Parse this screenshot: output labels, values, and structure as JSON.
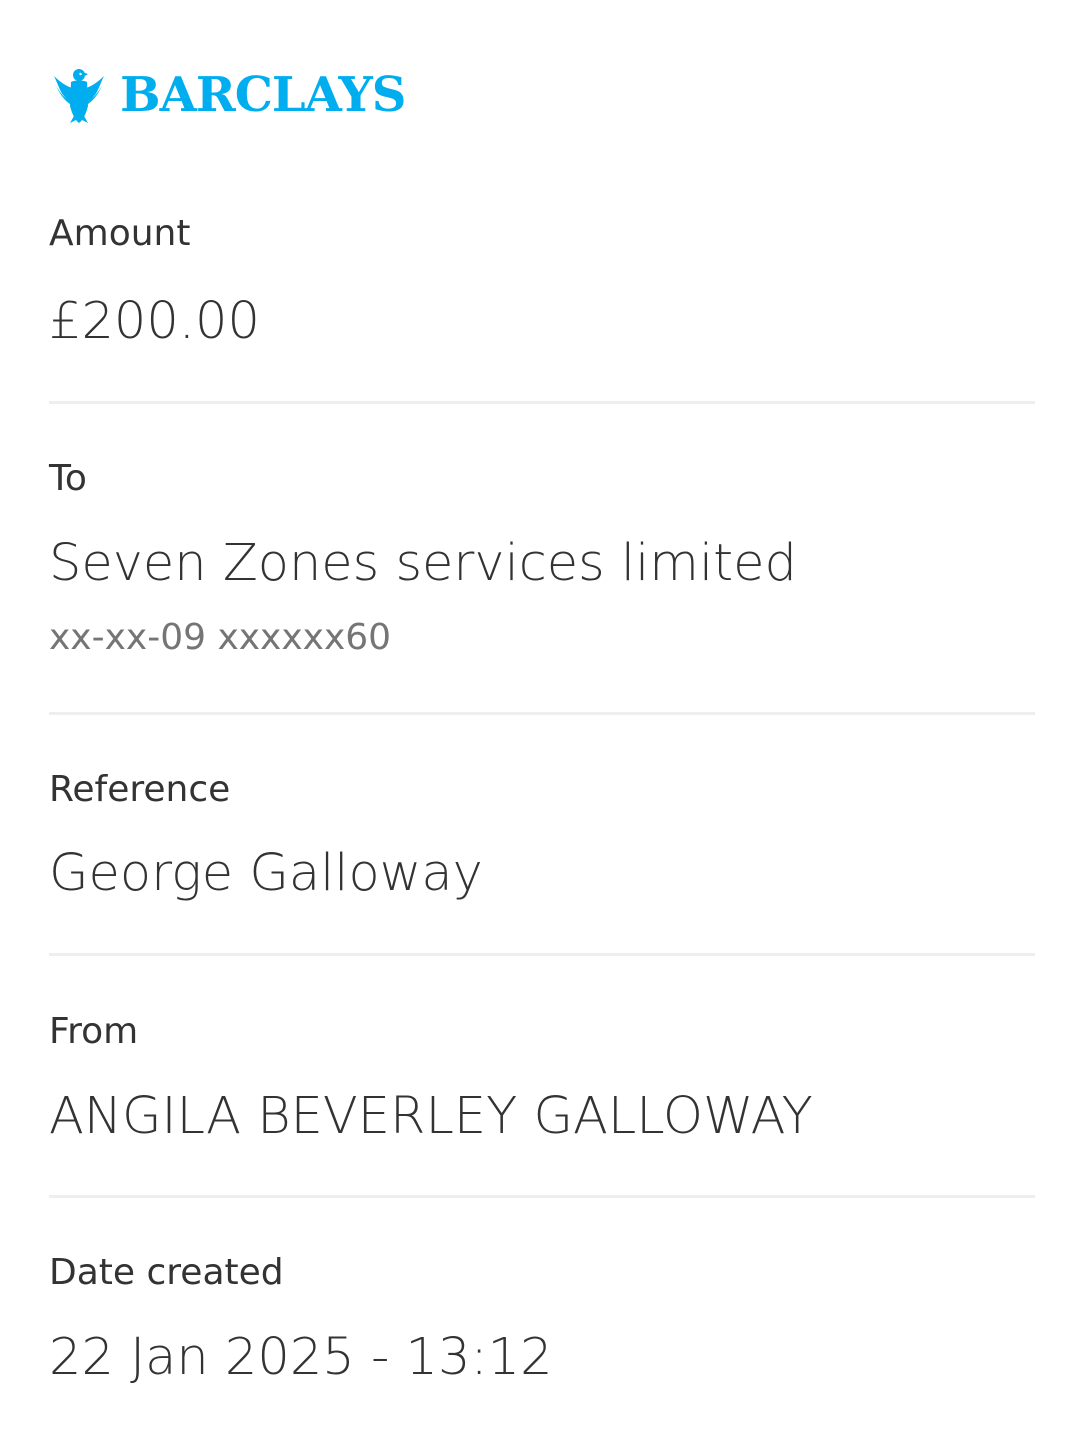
{
  "brand": {
    "name": "BARCLAYS",
    "logo_icon": "eagle-icon",
    "color": "#00AEEF"
  },
  "details": {
    "amount": {
      "label": "Amount",
      "value": "£200.00"
    },
    "to": {
      "label": "To",
      "value": "Seven Zones services limited",
      "account": "xx-xx-09 xxxxxx60"
    },
    "reference": {
      "label": "Reference",
      "value": "George Galloway"
    },
    "from": {
      "label": "From",
      "value": "ANGILA BEVERLEY GALLOWAY"
    },
    "date_created": {
      "label": "Date created",
      "value": "22 Jan 2025 - 13:12"
    }
  },
  "colors": {
    "text": "#333333",
    "secondary_text": "#757575",
    "divider": "#EEEEEE",
    "background": "#FFFFFF"
  }
}
